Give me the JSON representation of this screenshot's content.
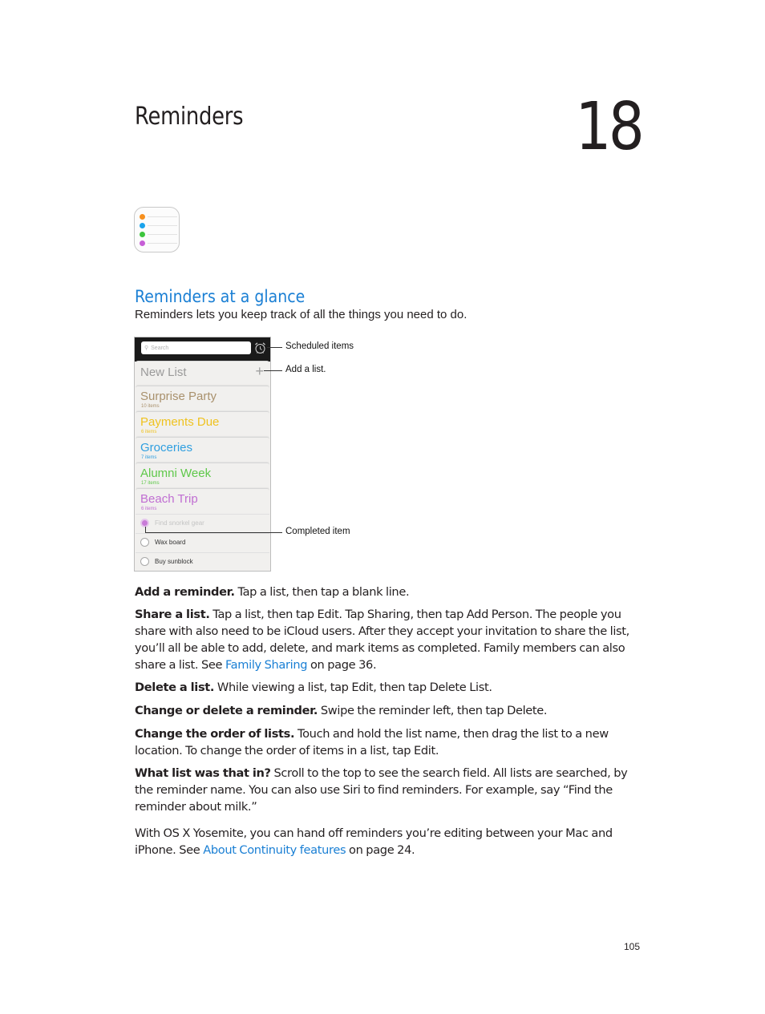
{
  "chapter": {
    "title": "Reminders",
    "number": "18"
  },
  "app_icon": {
    "name": "reminders-app-icon",
    "dot_colors": [
      "#f7901e",
      "#1aa3ec",
      "#3dc53d",
      "#c65ed6"
    ]
  },
  "section": {
    "title": "Reminders at a glance",
    "intro": "Reminders lets you keep track of all the things you need to do."
  },
  "phone": {
    "search_placeholder": "Search",
    "new_list_label": "New List",
    "lists": [
      {
        "name": "Surprise Party",
        "count": "10 items",
        "color": "#a9916d"
      },
      {
        "name": "Payments Due",
        "count": "6 items",
        "color": "#efc21f"
      },
      {
        "name": "Groceries",
        "count": "7 items",
        "color": "#2f9fe0"
      },
      {
        "name": "Alumni Week",
        "count": "17 items",
        "color": "#5fc84a"
      },
      {
        "name": "Beach Trip",
        "count": "6 items",
        "color": "#c06ed2"
      }
    ],
    "items": [
      {
        "label": "Find snorkel gear",
        "completed": true
      },
      {
        "label": "Wax board",
        "completed": false
      },
      {
        "label": "Buy sunblock",
        "completed": false
      }
    ]
  },
  "callouts": {
    "scheduled": "Scheduled items",
    "add_list": "Add a list.",
    "completed": "Completed item"
  },
  "paragraphs": {
    "add_reminder": {
      "lead": "Add a reminder.",
      "text": " Tap a list, then tap a blank line."
    },
    "share_list": {
      "lead": "Share a list.",
      "text": " Tap a list, then tap Edit. Tap Sharing, then tap Add Person. The people you share with also need to be iCloud users. After they accept your invitation to share the list, you’ll all be able to add, delete, and mark items as completed. Family members can also share a list. See ",
      "link": "Family Sharing",
      "after": " on page 36."
    },
    "delete_list": {
      "lead": "Delete a list.",
      "text": " While viewing a list, tap Edit, then tap Delete List."
    },
    "change_reminder": {
      "lead": "Change or delete a reminder.",
      "text": " Swipe the reminder left, then tap Delete."
    },
    "order_lists": {
      "lead": "Change the order of lists.",
      "text": " Touch and hold the list name, then drag the list to a new location. To change the order of items in a list, tap Edit."
    },
    "what_list": {
      "lead": "What list was that in?",
      "text": " Scroll to the top to see the search field. All lists are searched, by the reminder name. You can also use Siri to find reminders. For example, say “Find the reminder about milk.”"
    },
    "yosemite": {
      "text": "With OS X Yosemite, you can hand off reminders you’re editing between your Mac and iPhone. See ",
      "link": "About Continuity features",
      "after": " on page 24."
    }
  },
  "page_number": "105"
}
